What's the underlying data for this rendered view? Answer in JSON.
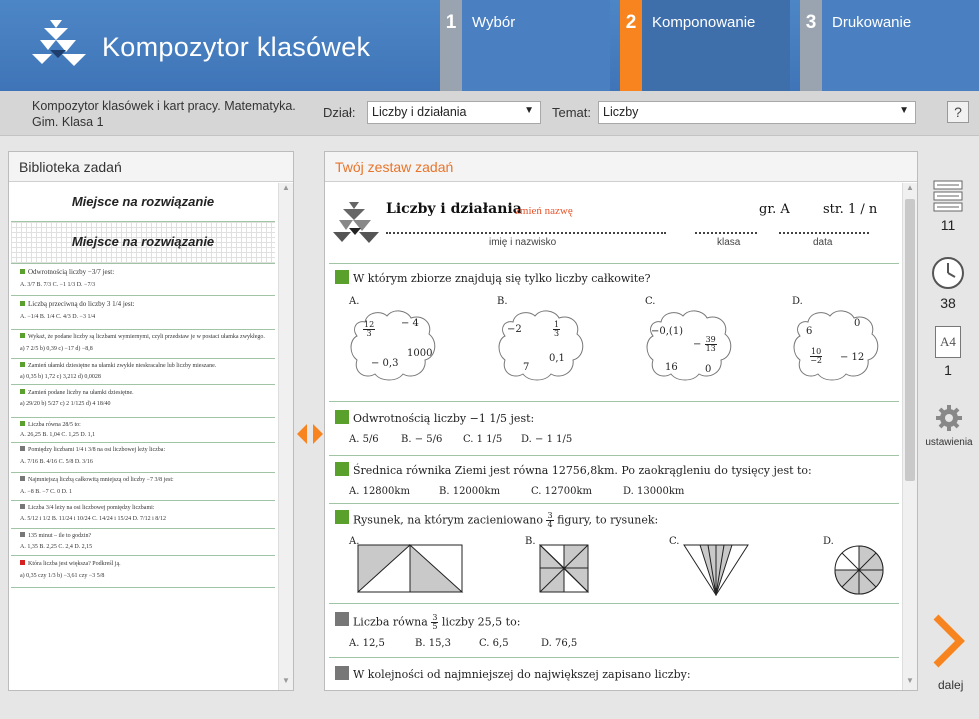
{
  "app": {
    "title": "Kompozytor klasówek"
  },
  "steps": [
    {
      "num": "1",
      "label": "Wybór"
    },
    {
      "num": "2",
      "label": "Komponowanie"
    },
    {
      "num": "3",
      "label": "Drukowanie"
    }
  ],
  "subbar": {
    "course": "Kompozytor klasówek i kart pracy. Matematyka. Gim. Klasa 1",
    "dzial_label": "Dział:",
    "dzial_value": "Liczby i działania",
    "temat_label": "Temat:",
    "temat_value": "Liczby",
    "help": "?"
  },
  "library": {
    "title": "Biblioteka zadań",
    "solution_text": "Miejsce na rozwiązanie",
    "items": [
      {
        "color": "#5aa02c",
        "text": "Odwrotnością liczby −3/7 jest:",
        "answers": "A. 3/7     B. 7/3     C. −1 1/3     D. −7/3"
      },
      {
        "color": "#5aa02c",
        "text": "Liczbą przeciwną do liczby 3 1/4 jest:",
        "answers": "A. −1/4     B. 1/4     C. 4/3     D. −3 1/4"
      },
      {
        "color": "#5aa02c",
        "text": "Wykaż, że podane liczby są liczbami wymiernymi, czyli przedstaw je w postaci ułamka zwykłego.",
        "answers": "a) 7 2/5     b) 0,39     c) −17     d) −8,8"
      },
      {
        "color": "#5aa02c",
        "text": "Zamień ułamki dziesiętne na ułamki zwykłe nieskracalne lub liczby mieszane.",
        "answers": "a) 0,35     b) 1,72     c) 3,212     d) 0,0028"
      },
      {
        "color": "#5aa02c",
        "text": "Zamień podane liczby na ułamki dziesiętne.",
        "answers": "a) 29/20     b) 5/27     c) 2 1/125     d) 4 18/40"
      },
      {
        "color": "#5aa02c",
        "text": "Liczba równa 28/5 to:",
        "answers": "A. 26,25     B. 1,04     C. 1,25     D. 1,1"
      },
      {
        "color": "#777777",
        "text": "Pomiędzy liczbami 1/4 i 3/8 na osi liczbowej leży liczba:",
        "answers": "A. 7/16     B. 4/16     C. 5/8     D. 3/16"
      },
      {
        "color": "#777777",
        "text": "Najmniejszą liczbą całkowitą mniejszą od liczby −7 3/8 jest:",
        "answers": "A. −8     B. −7     C. 0     D. 1"
      },
      {
        "color": "#777777",
        "text": "Liczba 3/4 leży na osi liczbowej pomiędzy liczbami:",
        "answers": "A. 5/12 i 1/2     B. 11/24 i 10/24     C. 14/24 i 15/24     D. 7/12 i 8/12"
      },
      {
        "color": "#777777",
        "text": "135 minut – ile to godzin?",
        "answers": "A. 1,35     B. 2,25     C. 2,4     D. 2,15"
      },
      {
        "color": "#d62020",
        "text": "Która liczba jest większa? Podkreśl ją.",
        "answers": "a) 0,35 czy 1/3               b) −3,61 czy −3 5/8"
      }
    ]
  },
  "set": {
    "title": "Twój zestaw zadań",
    "sheet_title": "Liczby i działania",
    "rename": "zmień nazwę",
    "group": "gr. A",
    "page": "str. 1 / n",
    "fields": [
      "imię i nazwisko",
      "klasa",
      "data"
    ],
    "q1": {
      "text": "W którym zbiorze znajdują się tylko liczby całkowite?",
      "options": [
        "A.",
        "B.",
        "C.",
        "D."
      ],
      "A": [
        "12/3",
        "− 4",
        "1000",
        "− 0,3"
      ],
      "B": [
        "−2",
        "1/3",
        "0,1",
        "7"
      ],
      "C": [
        "−0,(1)",
        "− 39/13",
        "16",
        "0"
      ],
      "D": [
        "6",
        "0",
        "10/−2",
        "− 12"
      ]
    },
    "q2": {
      "text": "Odwrotnością liczby −1 1/5 jest:",
      "answers": [
        "A. 5/6",
        "B. − 5/6",
        "C. 1 1/5",
        "D. − 1 1/5"
      ]
    },
    "q3": {
      "text": "Średnica równika Ziemi jest równa 12756,8km. Po zaokrągleniu do tysięcy jest to:",
      "answers": [
        "A. 12800km",
        "B. 12000km",
        "C. 12700km",
        "D. 13000km"
      ]
    },
    "q4": {
      "text_pre": "Rysunek, na którym zacieniowano",
      "frac": "3/4",
      "text_post": "figury, to rysunek:",
      "options": [
        "A.",
        "B.",
        "C.",
        "D."
      ]
    },
    "q5": {
      "text_pre": "Liczba równa",
      "frac": "3/5",
      "text_post": "liczby 25,5 to:",
      "answers": [
        "A. 12,5",
        "B. 15,3",
        "C. 6,5",
        "D. 76,5"
      ]
    },
    "q6": {
      "text": "W kolejności od najmniejszej do największej zapisano liczby:"
    }
  },
  "sidebar": {
    "tasks_count": "11",
    "time_minutes": "38",
    "format_label": "A4",
    "pages": "1",
    "settings_label": "ustawienia",
    "next_label": "dalej"
  },
  "colors": {
    "accent": "#f7841f",
    "header": "#4a80c2",
    "green": "#5aa02c",
    "gray": "#777777"
  }
}
